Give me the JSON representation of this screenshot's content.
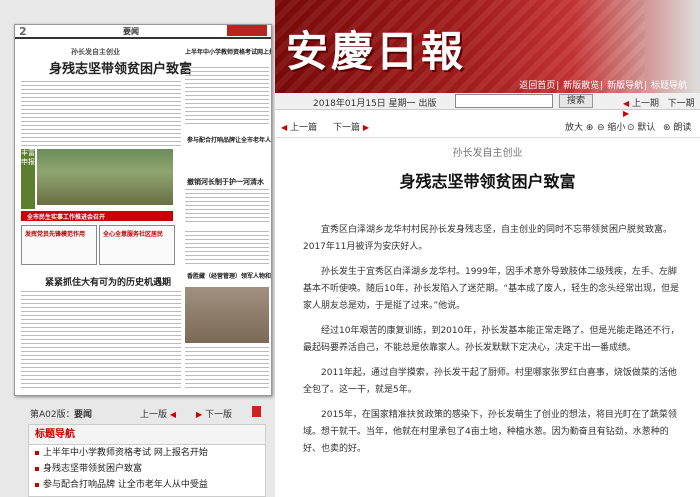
{
  "masthead": {
    "logo": "安慶日報"
  },
  "top_links": [
    "返回首页",
    "新版散览",
    "新版导航",
    "标题导航"
  ],
  "bar": {
    "date": "2018年01月15日 星期一 出版",
    "search_button": "搜索",
    "prev": "上一期",
    "next": "下一期"
  },
  "thumbnail": {
    "page_no": "2",
    "section": "要闻",
    "kicker": "孙长发自主创业",
    "headline": "身残志坚带领贫困户致富",
    "side_title": "上半年中小学教师资格考试网上报名开始",
    "side_title2": "参与配合打响品牌让全市老年人从中受益",
    "mid_title": "撤销河长制于护一河清水",
    "red_banner": "全市民生实事工作推进会召开",
    "box1": "发挥党员先锋模范作用",
    "box2": "全心全意服务社区居民",
    "bottom_title": "紧紧抓住大有可为的历史机遇期",
    "promo": "香胜藏（经营管理）领军人物和先进个人评选揭晓",
    "vertical1": "丰富申报",
    "vertical2": "展蓝图"
  },
  "pagebar": {
    "page": "第A02版：",
    "section": "要闻",
    "prev": "上一版",
    "next": "下一版"
  },
  "section_nav": {
    "title": "标题导航",
    "items": [
      "上半年中小学教师资格考试 网上报名开始",
      "身残志坚带领贫困户致富",
      "参与配合打响品牌 让全市老年人从中受益"
    ]
  },
  "article_toolbar": {
    "prev": "上一篇",
    "next": "下一篇",
    "zoom_in": "放大",
    "zoom_out": "缩小",
    "default": "默认",
    "read": "朗读"
  },
  "article": {
    "kicker": "孙长发自主创业",
    "headline": "身残志坚带领贫困户致富",
    "paragraphs": [
      "宜秀区白泽湖乡龙华村村民孙长发身残志坚，自主创业的同时不忘带领贫困户脱贫致富。2017年11月被评为安庆好人。",
      "孙长发生于宜秀区白泽湖乡龙华村。1999年，因手术意外导致肢体二级残疾，左手、左脚基本不听使唤。随后10年，孙长发陷入了迷茫期。“基本成了废人，轻生的念头经常出现，但是家人朋友总是劝，于是挺了过来。”他说。",
      "经过10年艰苦的康复训练，到2010年，孙长发基本能正常走路了。但是光能走路还不行，最起码要养活自己，不能总是依靠家人。孙长发默默下定决心，决定干出一番成绩。",
      "2011年起，通过自学摸索，孙长发干起了厨师。村里哪家张罗红白喜事，烧饭做菜的活他全包了。这一干，就是5年。",
      "2015年，在国家精准扶贫政策的感染下，孙长发萌生了创业的想法，将目光盯在了蔬菜领域。想干就干。当年，他就在村里承包了4亩土地，种植水葱。因为勤奋且有钻劲，水葱种的好、也卖的好。"
    ]
  },
  "colors": {
    "accent": "#c00000",
    "masthead": "#a51d1d"
  }
}
